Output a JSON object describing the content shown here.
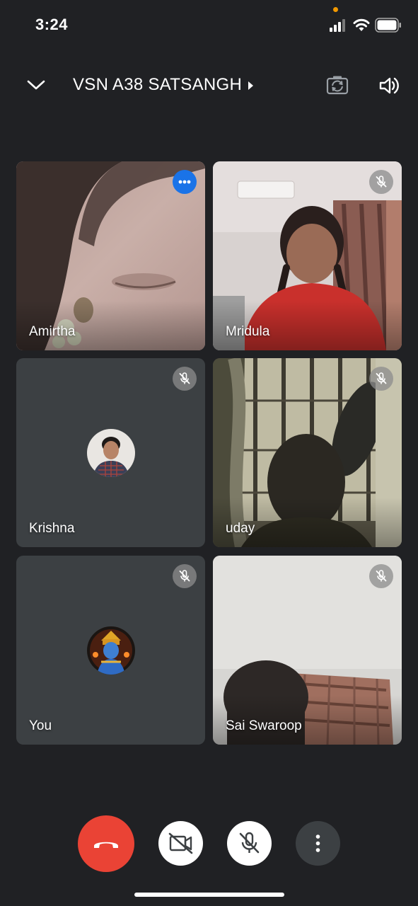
{
  "status_bar": {
    "time": "3:24"
  },
  "header": {
    "title": "VSN A38 SATSANGH"
  },
  "participants": [
    {
      "name": "Amirtha",
      "status": "more-options"
    },
    {
      "name": "Mridula",
      "status": "muted"
    },
    {
      "name": "Krishna",
      "status": "muted"
    },
    {
      "name": "uday",
      "status": "muted"
    },
    {
      "name": "You",
      "status": "muted"
    },
    {
      "name": "Sai Swaroop",
      "status": "muted"
    }
  ],
  "colors": {
    "background": "#202124",
    "end_call": "#ea4335",
    "more_badge": "#1a73e8",
    "tile_background": "#3c4043"
  },
  "icons": [
    "collapse-chevron-icon",
    "caret-right-icon",
    "switch-camera-icon",
    "speaker-icon",
    "more-horizontal-icon",
    "mic-off-icon",
    "end-call-icon",
    "camera-off-icon",
    "mic-off-icon",
    "more-vertical-icon"
  ]
}
